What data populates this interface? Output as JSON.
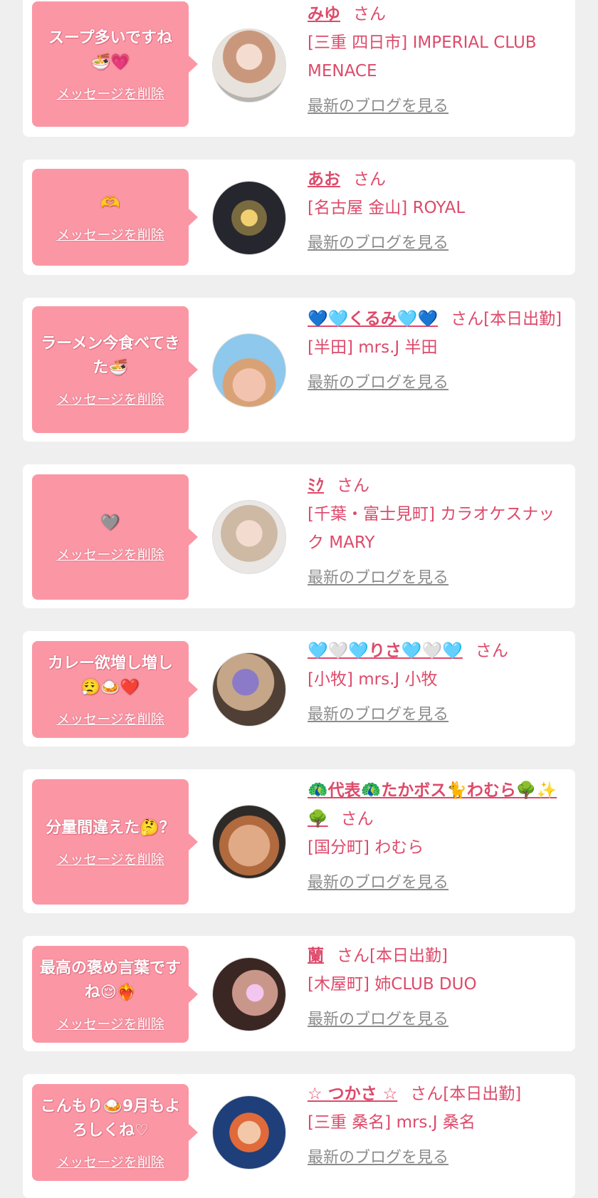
{
  "items": [
    {
      "message": "スープ多いですね🍜💗",
      "delete_label": "メッセージを削除",
      "name": "みゆ",
      "san": "さん",
      "shop": "[三重 四日市] IMPERIAL CLUB MENACE",
      "blog_label": "最新のブログを見る"
    },
    {
      "message": "🫶",
      "delete_label": "メッセージを削除",
      "name": "あお",
      "san": "さん",
      "shop": "[名古屋 金山] ROYAL",
      "blog_label": "最新のブログを見る"
    },
    {
      "message": "ラーメン今食べてきた🍜",
      "delete_label": "メッセージを削除",
      "name": "💙🩵くるみ🩵💙",
      "san": "さん[本日出勤]",
      "shop": "[半田] mrs.J 半田",
      "blog_label": "最新のブログを見る"
    },
    {
      "message": "🩶",
      "delete_label": "メッセージを削除",
      "name": "ﾐｸ",
      "san": "さん",
      "shop": "[千葉・富士見町] カラオケスナック MARY",
      "blog_label": "最新のブログを見る"
    },
    {
      "message": "カレー欲増し増し😮‍💨🍛❤️",
      "delete_label": "メッセージを削除",
      "name": "🩵🤍🩵りさ🩵🤍🩵",
      "san": "さん",
      "shop": "[小牧] mrs.J 小牧",
      "blog_label": "最新のブログを見る"
    },
    {
      "message": "分量間違えた🤔？",
      "delete_label": "メッセージを削除",
      "name": "🦚代表🦚たかボス🐈わむら🌳✨🌳",
      "san": "さん",
      "shop": "[国分町] わむら",
      "blog_label": "最新のブログを見る"
    },
    {
      "message": "最高の褒め言葉ですね😌❤️‍🔥",
      "delete_label": "メッセージを削除",
      "name": "蘭",
      "san": "さん[本日出勤]",
      "shop": "[木屋町] 姉CLUB DUO",
      "blog_label": "最新のブログを見る"
    },
    {
      "message": "こんもり🍛9月もよろしくね♡",
      "delete_label": "メッセージを削除",
      "name": "☆ つかさ ☆",
      "san": "さん[本日出勤]",
      "shop": "[三重 桑名] mrs.J 桑名",
      "blog_label": "最新のブログを見る"
    }
  ],
  "colors": {
    "bubble": "#fb97a5",
    "accent": "#dd4a6a",
    "link_gray": "#8c8c8c",
    "background": "#efefef"
  }
}
